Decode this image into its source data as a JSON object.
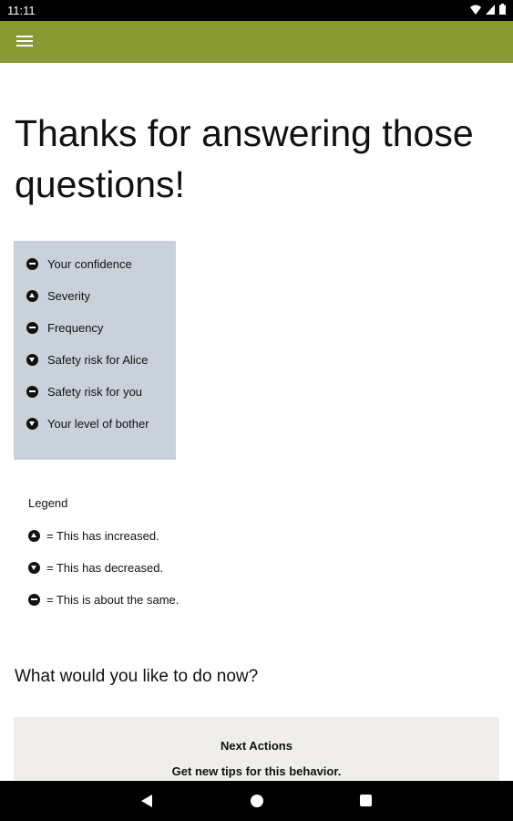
{
  "status_bar": {
    "time": "11:11"
  },
  "toolbar": {
    "menu_icon": "hamburger-menu-icon",
    "color": "#8a9a33"
  },
  "page": {
    "title": "Thanks for answering those questions!"
  },
  "summary": {
    "background": "#c9d2da",
    "items": [
      {
        "icon": "same",
        "label": "Your confidence"
      },
      {
        "icon": "up",
        "label": "Severity"
      },
      {
        "icon": "same",
        "label": "Frequency"
      },
      {
        "icon": "down",
        "label": "Safety risk for Alice"
      },
      {
        "icon": "same",
        "label": "Safety risk for you"
      },
      {
        "icon": "down",
        "label": "Your level of bother"
      }
    ]
  },
  "legend": {
    "title": "Legend",
    "items": [
      {
        "icon": "up",
        "label": "= This has increased."
      },
      {
        "icon": "down",
        "label": "= This has decreased."
      },
      {
        "icon": "same",
        "label": "= This is about the same."
      }
    ]
  },
  "prompt": {
    "question": "What would you like to do now?"
  },
  "next_actions": {
    "title": "Next Actions",
    "link": "Get new tips for this behavior."
  }
}
